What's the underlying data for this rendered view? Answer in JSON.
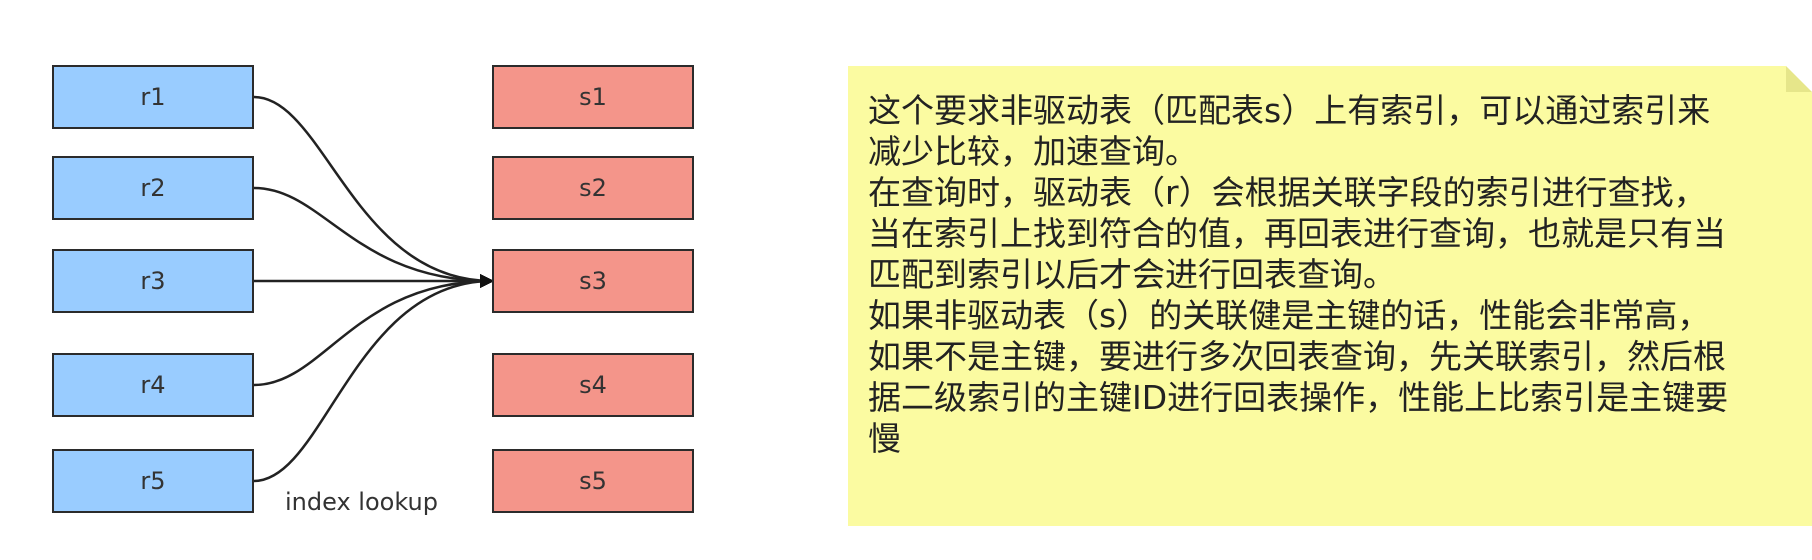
{
  "diagram": {
    "left_nodes": [
      "r1",
      "r2",
      "r3",
      "r4",
      "r5"
    ],
    "right_nodes": [
      "s1",
      "s2",
      "s3",
      "s4",
      "s5"
    ],
    "edges": [
      {
        "from": "r1",
        "to": "s3"
      },
      {
        "from": "r2",
        "to": "s3"
      },
      {
        "from": "r3",
        "to": "s3"
      },
      {
        "from": "r4",
        "to": "s3"
      },
      {
        "from": "r5",
        "to": "s3"
      }
    ],
    "edge_label": "index lookup",
    "colors": {
      "left_fill": "#99ccff",
      "right_fill": "#f4958a",
      "stroke": "#2b2b2b",
      "note_fill": "#fbfba1"
    }
  },
  "note": {
    "lines": [
      "这个要求非驱动表（匹配表s）上有索引，可以通过索引来",
      "减少比较，加速查询。",
      "在查询时，驱动表（r）会根据关联字段的索引进行查找，",
      "当在索引上找到符合的值，再回表进行查询，也就是只有当",
      "匹配到索引以后才会进行回表查询。",
      "如果非驱动表（s）的关联健是主键的话，性能会非常高，",
      "如果不是主键，要进行多次回表查询，先关联索引，然后根",
      "据二级索引的主键ID进行回表操作，性能上比索引是主键要",
      "慢"
    ]
  }
}
